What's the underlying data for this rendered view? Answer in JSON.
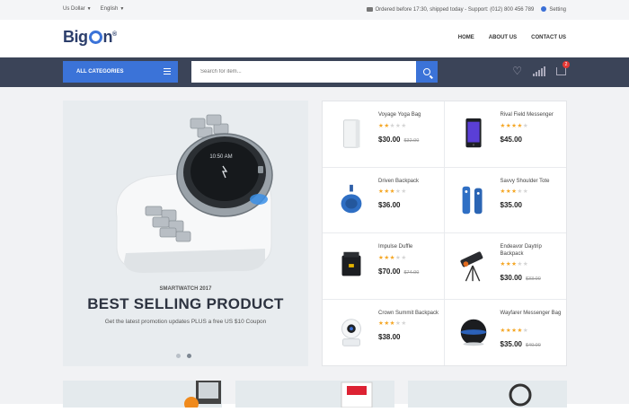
{
  "topbar": {
    "currency": "Us Dollar",
    "language": "English",
    "shipping": "Ordered before 17:30, shipped today - Support: (012) 800 456 789",
    "setting": "Setting"
  },
  "header": {
    "logo_prefix": "Big",
    "logo_suffix": "n",
    "nav": [
      "HOME",
      "ABOUT US",
      "CONTACT US"
    ]
  },
  "searchbar": {
    "categories_label": "ALL CATEGORIES",
    "search_placeholder": "Search for item...",
    "cart_count": "2"
  },
  "hero": {
    "subtitle": "SMARTWATCH 2017",
    "title": "BEST SELLING PRODUCT",
    "description": "Get the latest promotion updates PLUS a free US $10 Coupon",
    "watch_time": "10:50 AM",
    "slides": 2,
    "active_slide": 2
  },
  "products": [
    {
      "name": "Voyage Yoga Bag",
      "rating": 2,
      "price": "$30.00",
      "old_price": "$32.00",
      "icon": "white-box"
    },
    {
      "name": "Rival Field Messenger",
      "rating": 4,
      "price": "$45.00",
      "old_price": "",
      "icon": "smartphone"
    },
    {
      "name": "Driven Backpack",
      "rating": 3,
      "price": "$36.00",
      "old_price": "",
      "icon": "blue-speaker"
    },
    {
      "name": "Savvy Shoulder Tote",
      "rating": 3,
      "price": "$35.00",
      "old_price": "",
      "icon": "remote-controls"
    },
    {
      "name": "Impulse Duffle",
      "rating": 3,
      "price": "$70.00",
      "old_price": "$74.00",
      "icon": "power-adapter"
    },
    {
      "name": "Endeavor Daytrip Backpack",
      "rating": 3,
      "price": "$30.00",
      "old_price": "$33.00",
      "icon": "telescope"
    },
    {
      "name": "Crown Summit Backpack",
      "rating": 3,
      "price": "$38.00",
      "old_price": "",
      "icon": "security-camera"
    },
    {
      "name": "Wayfarer Messenger Bag",
      "rating": 4,
      "price": "$35.00",
      "old_price": "$40.00",
      "icon": "black-speaker"
    }
  ],
  "colors": {
    "accent": "#3b73d8",
    "dark_bar": "#3b4458",
    "star": "#f5a623"
  }
}
